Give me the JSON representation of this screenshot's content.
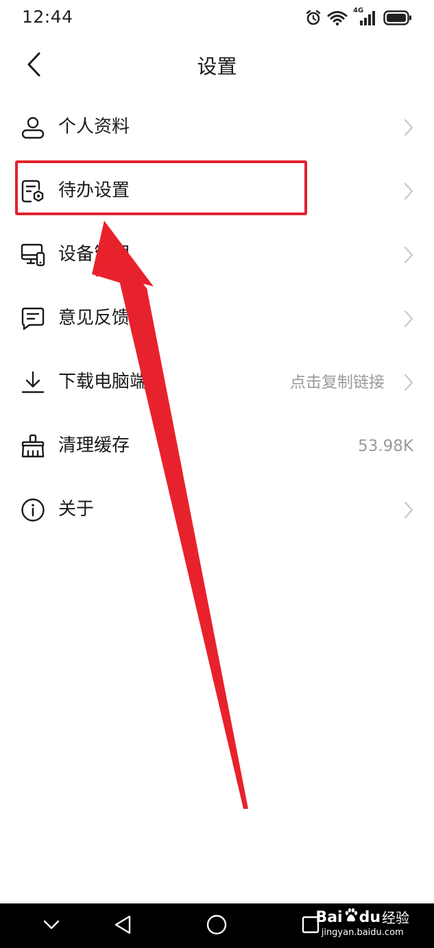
{
  "status_bar": {
    "time": "12:44",
    "network_label": "4G",
    "icons": [
      "alarm-icon",
      "wifi-icon",
      "signal-icon",
      "battery-icon"
    ]
  },
  "header": {
    "title": "设置",
    "back_icon": "chevron-left-icon"
  },
  "settings": {
    "items": [
      {
        "id": "profile",
        "label": "个人资料",
        "icon": "user-icon",
        "value": "",
        "chevron": true
      },
      {
        "id": "todo",
        "label": "待办设置",
        "icon": "todo-settings-icon",
        "value": "",
        "chevron": true
      },
      {
        "id": "devices",
        "label": "设备管理",
        "icon": "devices-icon",
        "value": "",
        "chevron": true
      },
      {
        "id": "feedback",
        "label": "意见反馈",
        "icon": "message-icon",
        "value": "",
        "chevron": true
      },
      {
        "id": "download",
        "label": "下载电脑端",
        "icon": "download-icon",
        "value": "点击复制链接",
        "chevron": true
      },
      {
        "id": "cache",
        "label": "清理缓存",
        "icon": "broom-icon",
        "value": "53.98K",
        "chevron": false
      },
      {
        "id": "about",
        "label": "关于",
        "icon": "info-icon",
        "value": "",
        "chevron": true
      }
    ]
  },
  "annotation": {
    "highlight_color": "#e0222e",
    "highlighted_item": "待办设置"
  },
  "watermark": {
    "brand": "Bai",
    "brand_suffix": "du",
    "product": "经验",
    "url": "jingyan.baidu.com"
  },
  "colors": {
    "text": "#1a1a1a",
    "secondary_text": "#9a9a9a",
    "chevron": "#c8c8c8",
    "nav_bar": "#000000"
  }
}
